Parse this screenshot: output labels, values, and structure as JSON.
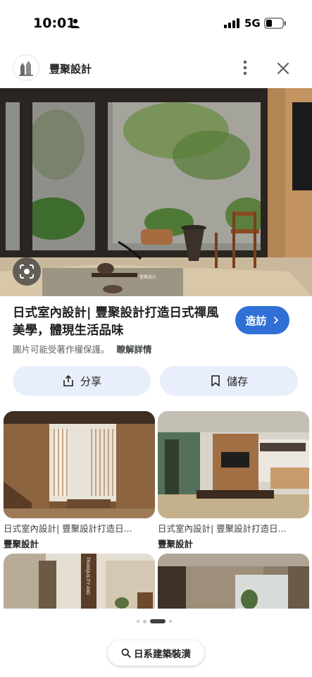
{
  "status": {
    "time": "10:01",
    "network": "5G"
  },
  "header": {
    "site_name": "豐聚設計"
  },
  "hero": {
    "watermark": "豐聚設計"
  },
  "title": "日式室內設計| 豐聚設計打造日式禪風美學，體現生活品味",
  "visit_label": "造訪",
  "copyright_note": "圖片可能受著作權保護。",
  "learn_more": "瞭解詳情",
  "actions": {
    "share": "分享",
    "save": "儲存"
  },
  "results": [
    {
      "title": "日式室內設計| 豐聚設計打造日...",
      "source": "豐聚設計"
    },
    {
      "title": "日式室內設計| 豐聚設計打造日...",
      "source": "豐聚設計"
    }
  ],
  "partial_card_text": "TRANQUILITY AND",
  "search_chip": "日系建築裝潢",
  "icons": [
    "person-icon",
    "signal-icon",
    "battery-icon",
    "more-vert-icon",
    "close-icon",
    "lens-icon",
    "share-icon",
    "bookmark-icon",
    "chevron-right-icon",
    "search-icon"
  ],
  "colors": {
    "accent": "#2f6fd6",
    "action_bg": "#e8eefb"
  }
}
